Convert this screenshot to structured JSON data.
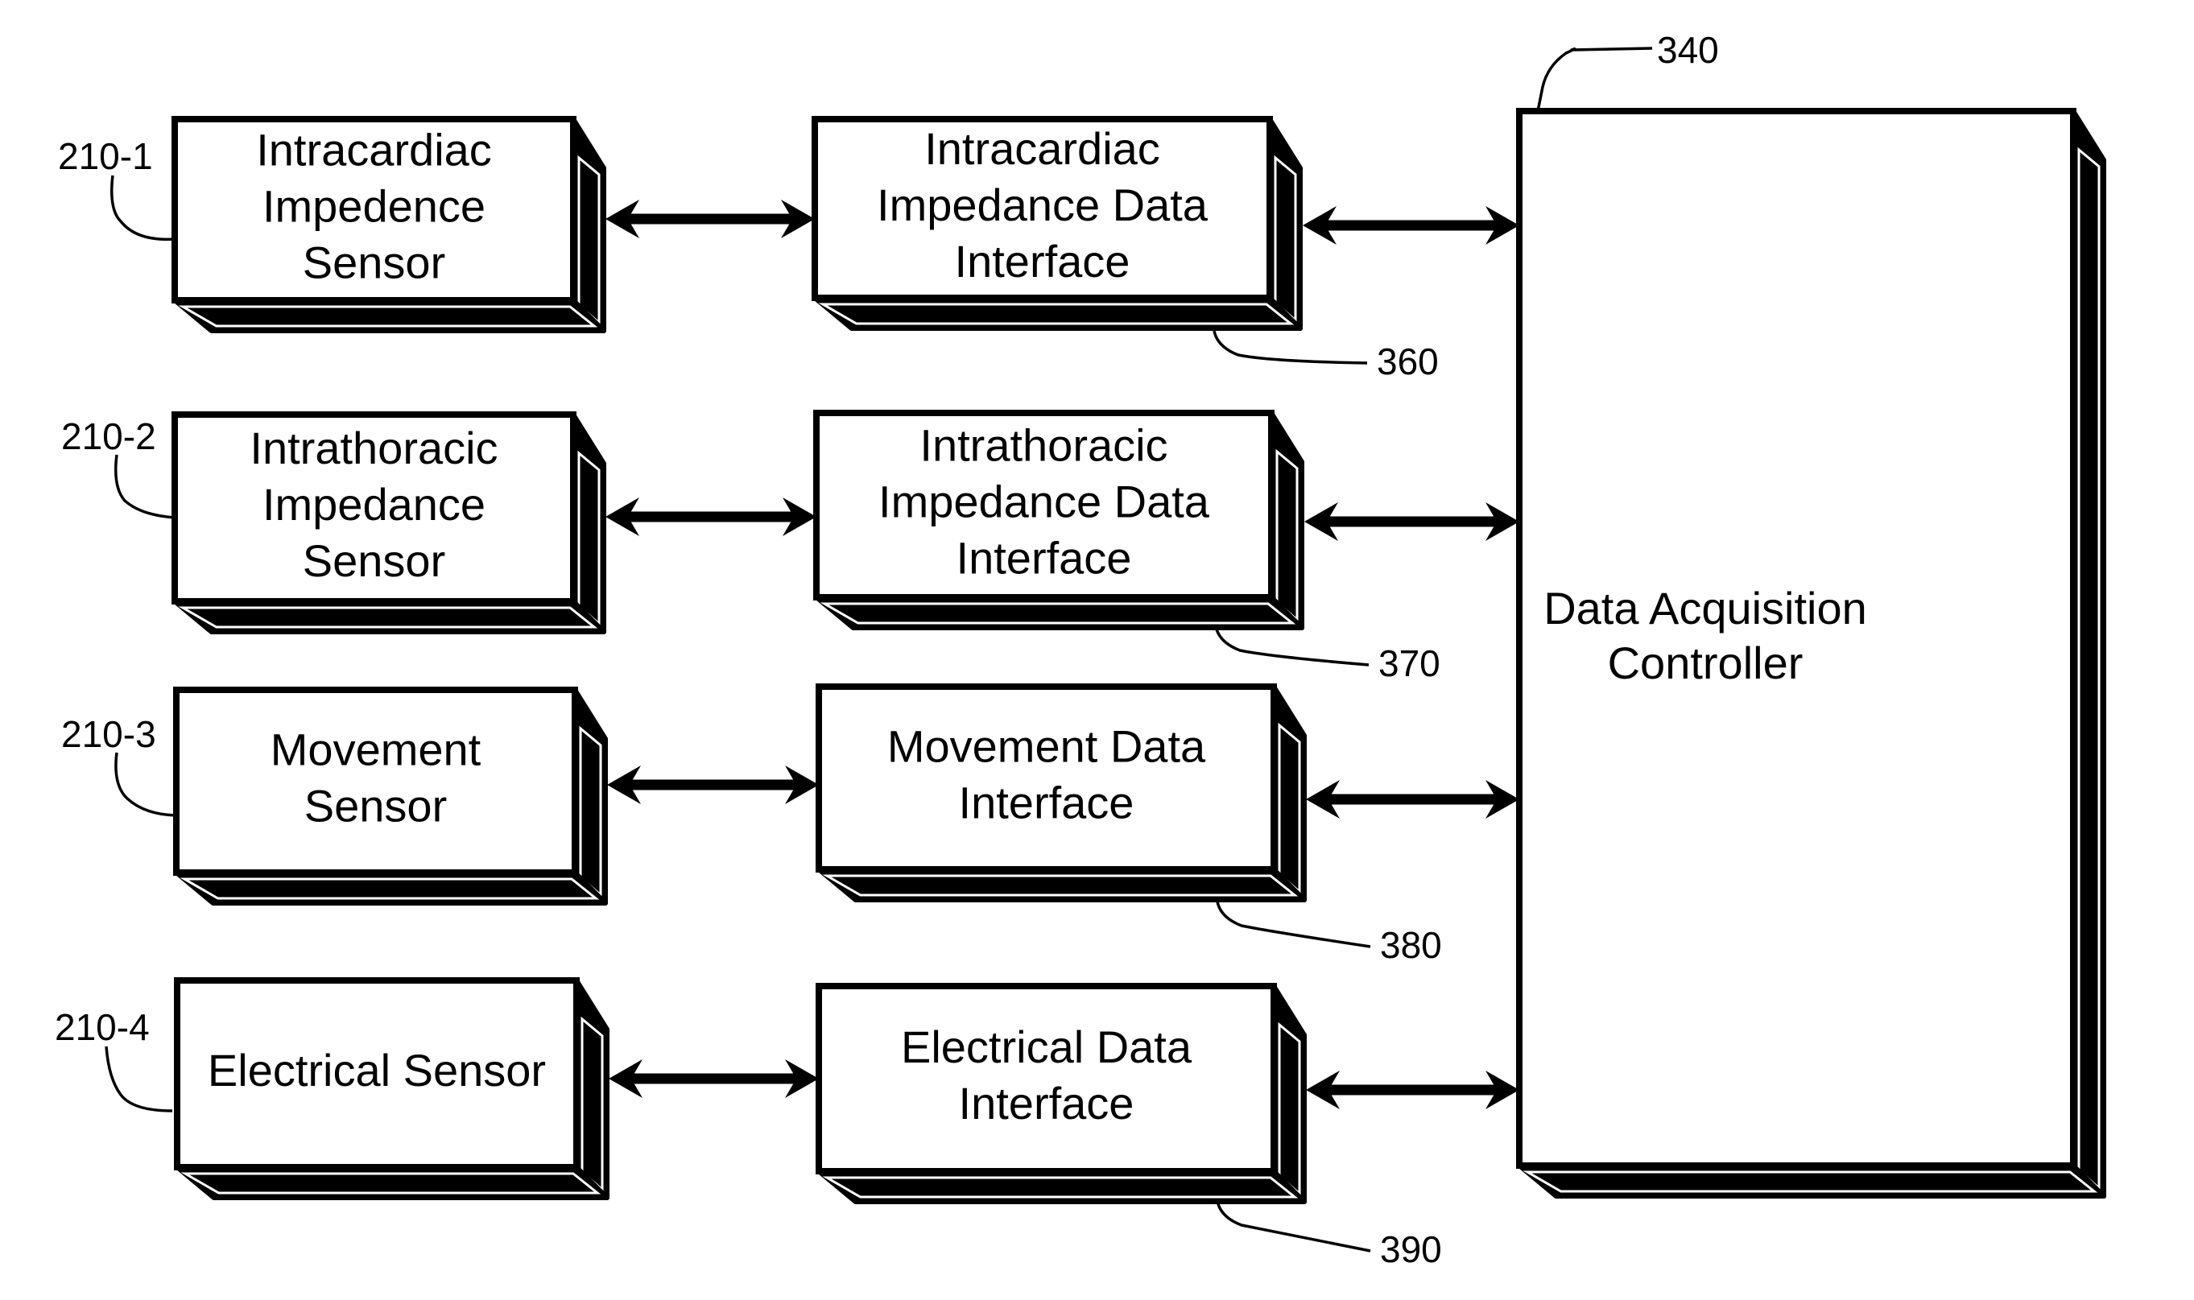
{
  "diagram": {
    "sensors": [
      {
        "ref": "210-1",
        "lines": [
          "Intracardiac",
          "Impedence",
          "Sensor"
        ]
      },
      {
        "ref": "210-2",
        "lines": [
          "Intrathoracic",
          "Impedance",
          "Sensor"
        ]
      },
      {
        "ref": "210-3",
        "lines": [
          "Movement",
          "Sensor"
        ]
      },
      {
        "ref": "210-4",
        "lines": [
          "Electrical Sensor"
        ]
      }
    ],
    "interfaces": [
      {
        "ref": "360",
        "lines": [
          "Intracardiac",
          "Impedance Data",
          "Interface"
        ]
      },
      {
        "ref": "370",
        "lines": [
          "Intrathoracic",
          "Impedance Data",
          "Interface"
        ]
      },
      {
        "ref": "380",
        "lines": [
          "Movement Data",
          "Interface"
        ]
      },
      {
        "ref": "390",
        "lines": [
          "Electrical Data",
          "Interface"
        ]
      }
    ],
    "controller": {
      "ref": "340",
      "lines": [
        "Data Acquisition",
        "Controller"
      ]
    },
    "connections": [
      {
        "from": "210-1",
        "to": "360",
        "type": "bidirectional"
      },
      {
        "from": "210-2",
        "to": "370",
        "type": "bidirectional"
      },
      {
        "from": "210-3",
        "to": "380",
        "type": "bidirectional"
      },
      {
        "from": "210-4",
        "to": "390",
        "type": "bidirectional"
      },
      {
        "from": "360",
        "to": "340",
        "type": "bidirectional"
      },
      {
        "from": "370",
        "to": "340",
        "type": "bidirectional"
      },
      {
        "from": "380",
        "to": "340",
        "type": "bidirectional"
      },
      {
        "from": "390",
        "to": "340",
        "type": "bidirectional"
      }
    ]
  }
}
